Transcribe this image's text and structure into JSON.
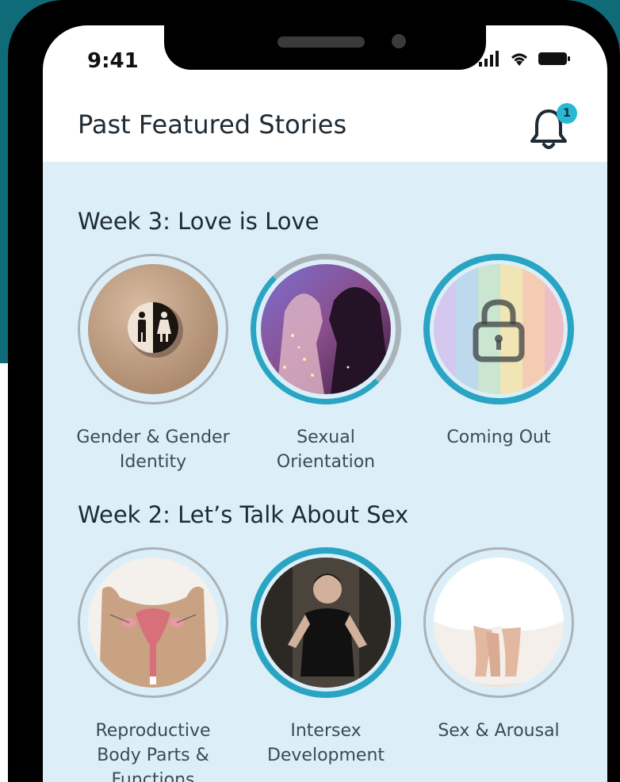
{
  "status_bar": {
    "time": "9:41"
  },
  "header": {
    "title": "Past Featured Stories",
    "notification_count": "1"
  },
  "sections": [
    {
      "title": "Week 3: Love is Love",
      "stories": [
        {
          "label": "Gender & Gender Identity",
          "image": "restroom-sign-icon",
          "progress": "not-started"
        },
        {
          "label": "Sexual Orientation",
          "image": "couple-photo",
          "progress": "partial"
        },
        {
          "label": "Coming Out",
          "image": "rainbow-flag-photo",
          "progress": "locked"
        }
      ]
    },
    {
      "title": "Week 2: Let’s Talk About Sex",
      "stories": [
        {
          "label": "Reproductive Body Parts & Functions",
          "image": "reproductive-diagram",
          "progress": "not-started"
        },
        {
          "label": "Intersex Development",
          "image": "person-photo",
          "progress": "complete"
        },
        {
          "label": "Sex & Arousal",
          "image": "feet-in-bed-photo",
          "progress": "not-started"
        }
      ]
    }
  ],
  "colors": {
    "accent": "#29a5c3",
    "content_bg": "#dceff8",
    "teal_bg": "#0f6b78"
  }
}
